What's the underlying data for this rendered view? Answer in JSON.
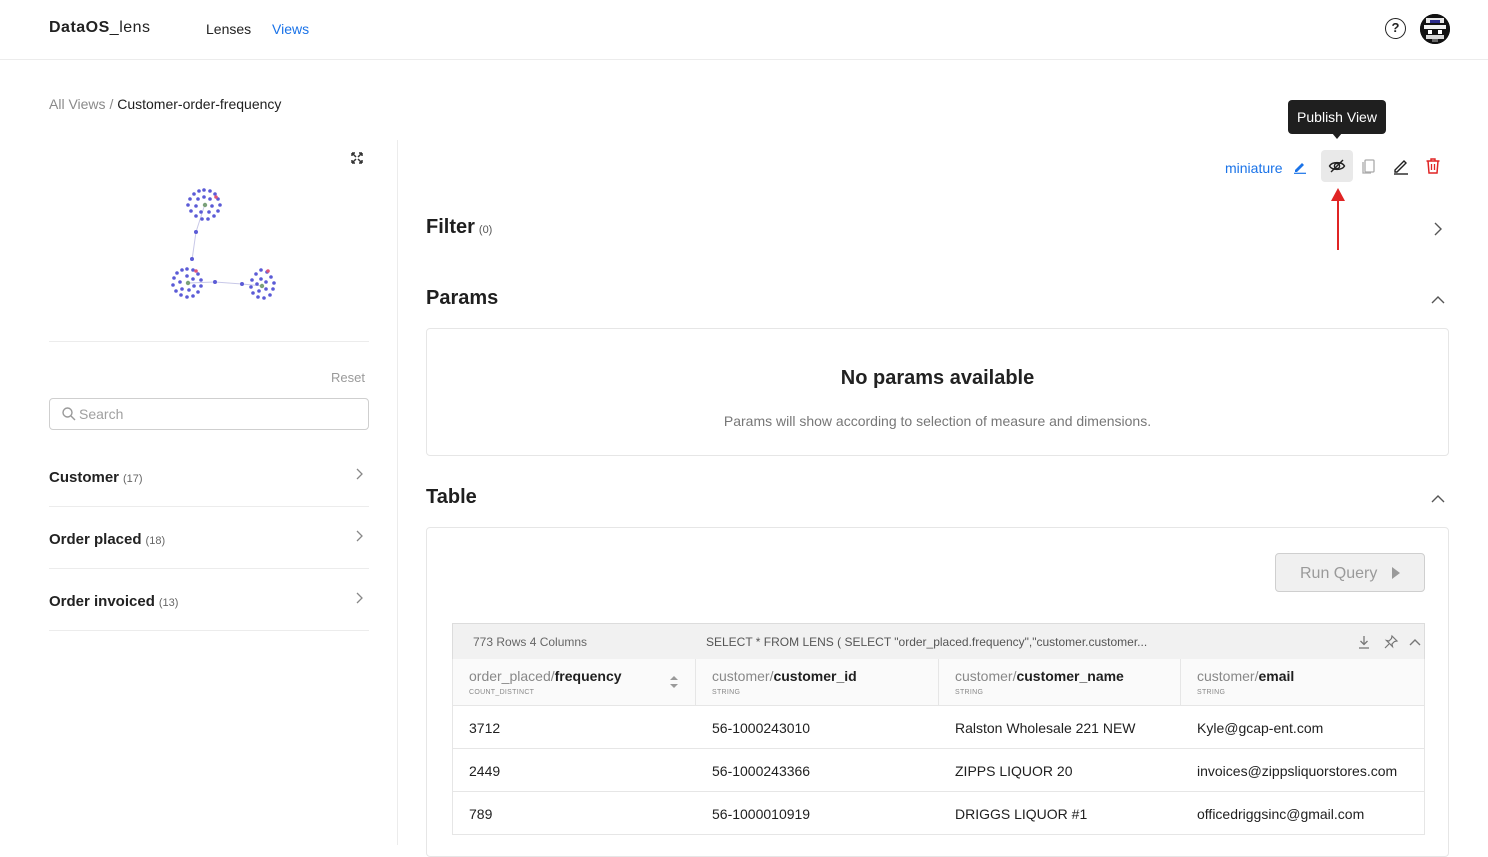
{
  "header": {
    "brand_a": "DataOS",
    "brand_b": "_lens",
    "nav": [
      "Lenses",
      "Views"
    ]
  },
  "breadcrumb": {
    "root": "All Views",
    "separator": "/",
    "current": "Customer-order-frequency"
  },
  "left_panel": {
    "reset_label": "Reset",
    "search_placeholder": "Search",
    "entities": [
      {
        "name": "Customer",
        "count": "(17)"
      },
      {
        "name": "Order placed",
        "count": "(18)"
      },
      {
        "name": "Order invoiced",
        "count": "(13)"
      }
    ]
  },
  "actions": {
    "lens_name": "miniature",
    "tooltip": "Publish View"
  },
  "filter": {
    "title": "Filter",
    "count": "(0)"
  },
  "params": {
    "title": "Params",
    "empty_title": "No params available",
    "empty_subtitle": "Params will show according to selection of measure and dimensions."
  },
  "table": {
    "title": "Table",
    "run_query_label": "Run Query",
    "meta": "773 Rows 4 Columns",
    "sql": "SELECT * FROM LENS ( SELECT \"order_placed.frequency\",\"customer.customer...",
    "columns": [
      {
        "prefix": "order_placed/",
        "field": "frequency",
        "type": "COUNT_DISTINCT"
      },
      {
        "prefix": "customer/",
        "field": "customer_id",
        "type": "STRING"
      },
      {
        "prefix": "customer/",
        "field": "customer_name",
        "type": "STRING"
      },
      {
        "prefix": "customer/",
        "field": "email",
        "type": "STRING"
      }
    ],
    "rows": [
      [
        "3712",
        "56-1000243010",
        "Ralston Wholesale 221 NEW",
        "Kyle@gcap-ent.com"
      ],
      [
        "2449",
        "56-1000243366",
        "ZIPPS LIQUOR 20",
        "invoices@zippsliquorstores.com"
      ],
      [
        "789",
        "56-1000010919",
        "DRIGGS LIQUOR #1",
        "officedriggsinc@gmail.com"
      ]
    ]
  },
  "colors": {
    "accent": "#1a73e8",
    "danger": "#e02424",
    "graph_node": "#5b5bd6",
    "graph_highlight": "#e0557a"
  },
  "icons": [
    "help-icon",
    "avatar",
    "expand-icon",
    "search-icon",
    "chevron-right-icon",
    "edit-icon",
    "eye-off-icon",
    "copy-icon",
    "pencil-icon",
    "trash-icon",
    "chevron-up-icon",
    "play-icon",
    "download-icon",
    "pin-icon",
    "sort-icon"
  ]
}
